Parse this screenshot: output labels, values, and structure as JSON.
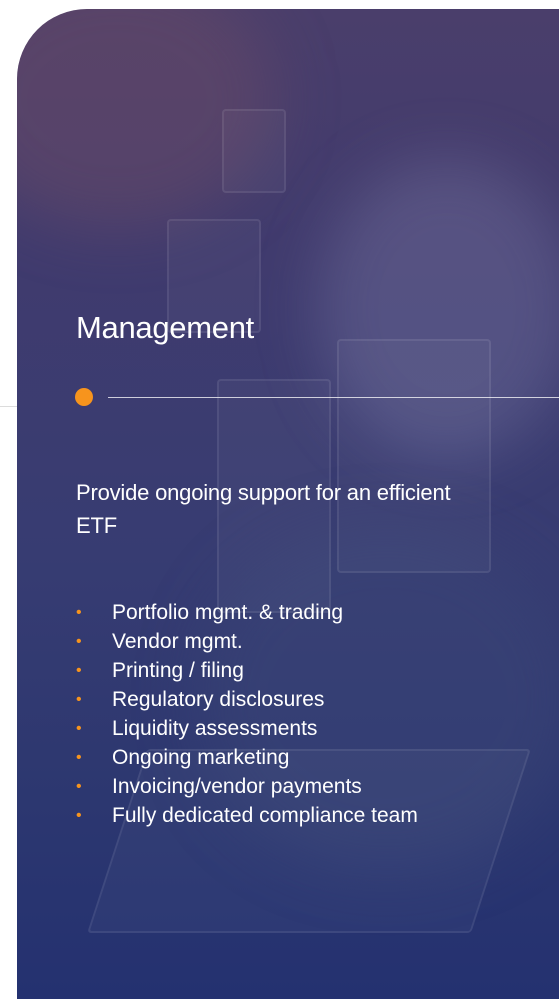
{
  "section": {
    "title": "Management",
    "subtitle": "Provide ongoing support for an efficient ETF",
    "bullet_glyph": "•",
    "items": [
      "Portfolio mgmt. & trading",
      "Vendor mgmt.",
      "Printing / filing",
      "Regulatory disclosures",
      "Liquidity assessments",
      "Ongoing marketing",
      "Invoicing/vendor payments",
      "Fully dedicated compliance team"
    ]
  },
  "colors": {
    "accent": "#f7941d",
    "card_top": "#4a3e6b",
    "card_bottom": "#243170",
    "text": "#ffffff"
  }
}
